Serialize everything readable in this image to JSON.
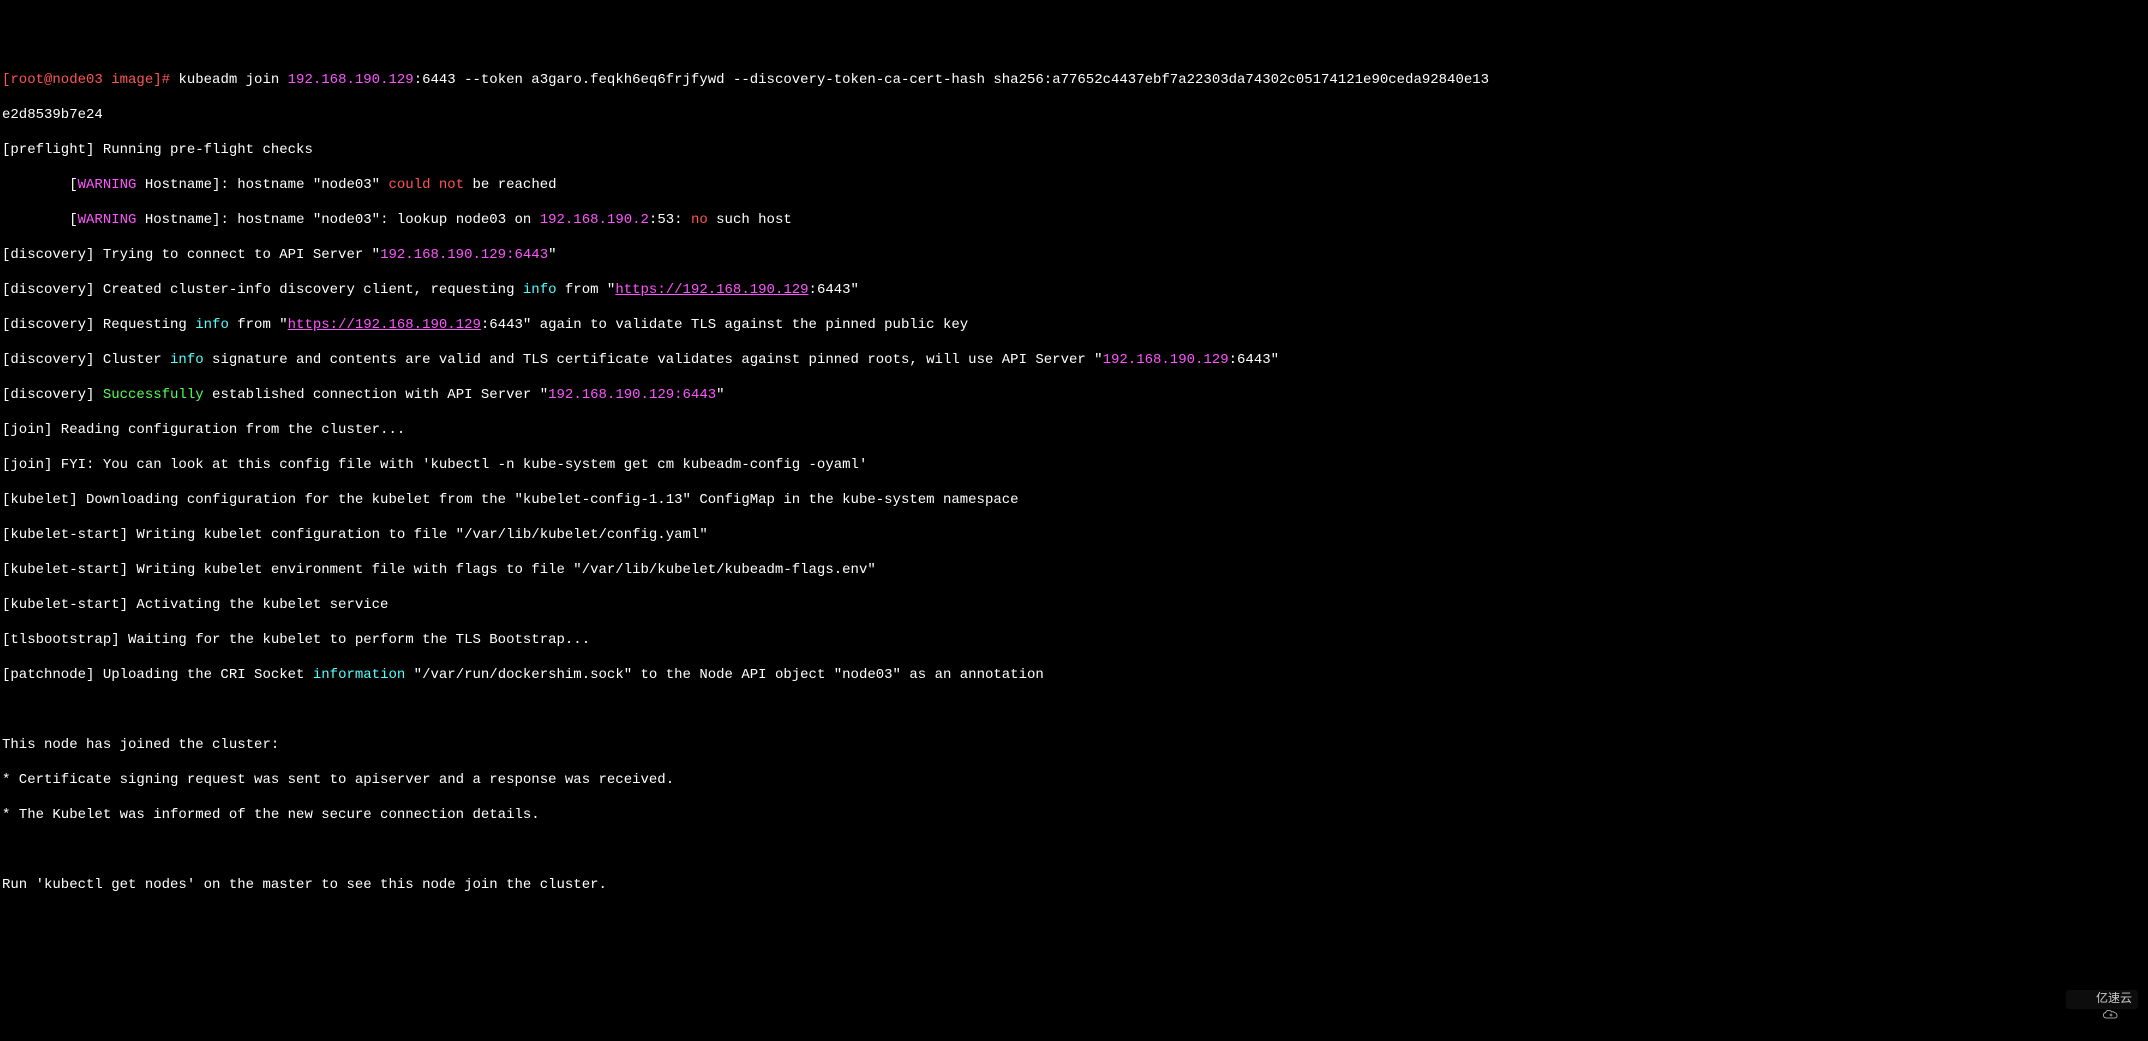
{
  "prompt": {
    "user_host": "[root@node03 image]# ",
    "cmd_pre": "kubeadm join ",
    "ip_port": "192.168.190.129",
    "cmd_post1": ":6443 --token a3garo.feqkh6eq6frjfywd --discovery-token-ca-cert-hash sha256:a77652c4437ebf7a22303da74302c05174121e90ceda92840e13",
    "cmd_line2": "e2d8539b7e24"
  },
  "preflight": {
    "checks": "[preflight] Running pre-flight checks",
    "warn1_pre": "        [",
    "warn1_tag": "WARNING",
    "warn1_mid": " Hostname]: hostname \"node03\" ",
    "warn1_could": "could",
    "warn1_sp": " ",
    "warn1_not": "not",
    "warn1_post": " be reached",
    "warn2_pre": "        [",
    "warn2_tag": "WARNING",
    "warn2_mid": " Hostname]: hostname \"node03\": lookup node03 on ",
    "warn2_ip": "192.168.190.2",
    "warn2_port": ":53: ",
    "warn2_no": "no",
    "warn2_post": " such host"
  },
  "discovery": {
    "d1_pre": "[discovery] Trying to connect to API Server \"",
    "d1_ip": "192.168.190.129:6443",
    "d1_post": "\"",
    "d2_pre": "[discovery] Created cluster-info discovery client, requesting ",
    "d2_info": "info",
    "d2_mid": " from \"",
    "d2_url": "https://192.168.190.129",
    "d2_post": ":6443\"",
    "d3_pre": "[discovery] Requesting ",
    "d3_info": "info",
    "d3_mid": " from \"",
    "d3_url": "https://192.168.190.129",
    "d3_post": ":6443\" again to validate TLS against the pinned public key",
    "d4_pre": "[discovery] Cluster ",
    "d4_info": "info",
    "d4_mid": " signature and contents are valid and TLS certificate validates against pinned roots, will use API Server \"",
    "d4_ip": "192.168.190.129",
    "d4_post": ":6443\"",
    "d5_pre": "[discovery] ",
    "d5_succ": "Successfully",
    "d5_mid": " established connection with API Server \"",
    "d5_ip": "192.168.190.129:6443",
    "d5_post": "\""
  },
  "join": {
    "j1": "[join] Reading configuration from the cluster...",
    "j2": "[join] FYI: You can look at this config file with 'kubectl -n kube-system get cm kubeadm-config -oyaml'"
  },
  "kubelet": {
    "k1": "[kubelet] Downloading configuration for the kubelet from the \"kubelet-config-1.13\" ConfigMap in the kube-system namespace",
    "k2": "[kubelet-start] Writing kubelet configuration to file \"/var/lib/kubelet/config.yaml\"",
    "k3": "[kubelet-start] Writing kubelet environment file with flags to file \"/var/lib/kubelet/kubeadm-flags.env\"",
    "k4": "[kubelet-start] Activating the kubelet service"
  },
  "tls": {
    "t1": "[tlsbootstrap] Waiting for the kubelet to perform the TLS Bootstrap..."
  },
  "patch": {
    "p1_pre": "[patchnode] Uploading the CRI Socket ",
    "p1_info": "information",
    "p1_post": " \"/var/run/dockershim.sock\" to the Node API object \"node03\" as an annotation"
  },
  "footer": {
    "f1": "This node has joined the cluster:",
    "f2": "* Certificate signing request was sent to apiserver and a response was received.",
    "f3": "* The Kubelet was informed of the new secure connection details.",
    "f4": "Run 'kubectl get nodes' on the master to see this node join the cluster."
  },
  "watermark": "亿速云"
}
